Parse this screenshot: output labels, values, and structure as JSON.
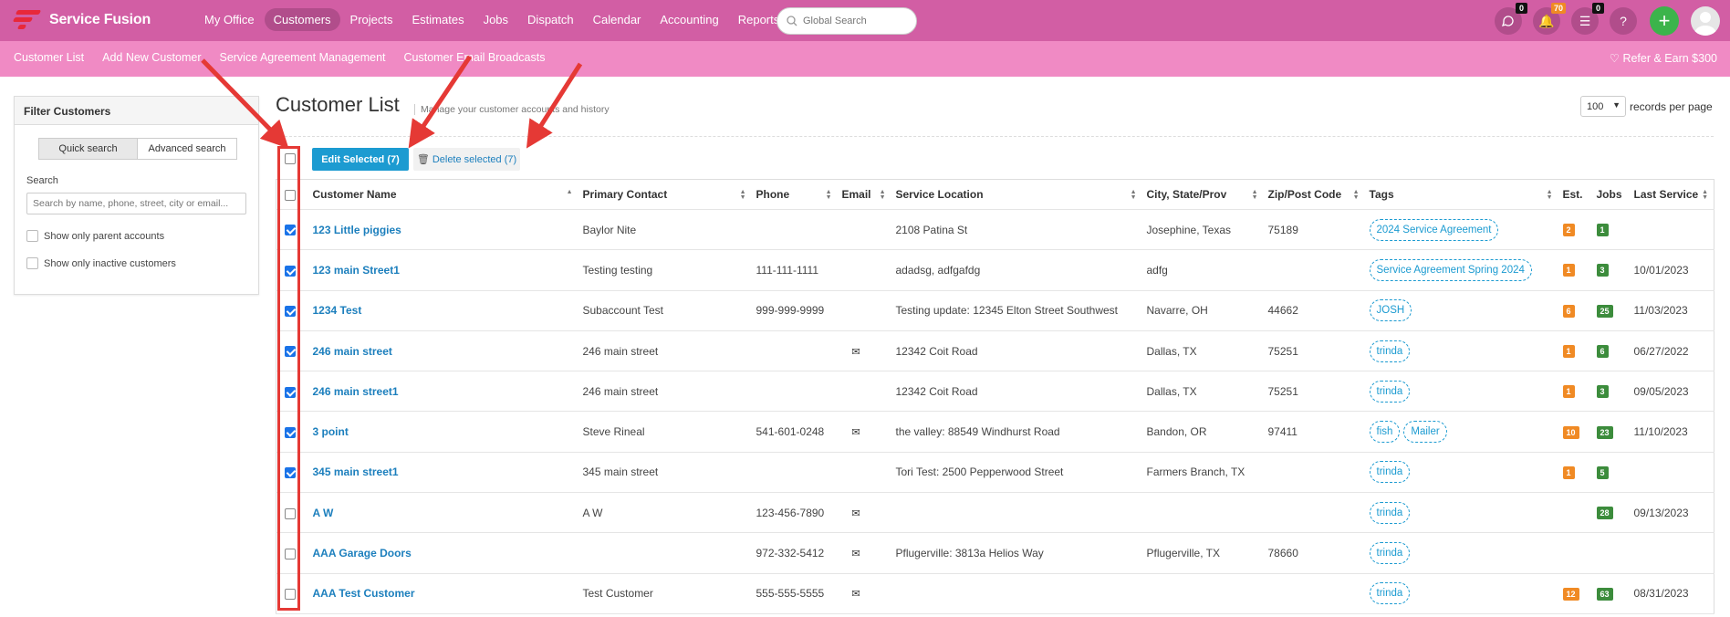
{
  "app": {
    "brand": "Service Fusion",
    "nav": [
      "My Office",
      "Customers",
      "Projects",
      "Estimates",
      "Jobs",
      "Dispatch",
      "Calendar",
      "Accounting",
      "Reports"
    ],
    "active_nav": "Customers",
    "search_placeholder": "Global Search",
    "chat_badge": "0",
    "bell_badge": "70",
    "list_badge": "0",
    "help": "?",
    "plus": "+"
  },
  "subnav": {
    "items": [
      "Customer List",
      "Add New Customer",
      "Service Agreement Management",
      "Customer Email Broadcasts"
    ],
    "refer": "Refer & Earn $300"
  },
  "filter": {
    "title": "Filter Customers",
    "quick": "Quick search",
    "advanced": "Advanced search",
    "search_label": "Search",
    "search_placeholder": "Search by name, phone, street, city or email...",
    "parent_only": "Show only parent accounts",
    "inactive_only": "Show only inactive customers"
  },
  "main": {
    "title": "Customer List",
    "subtitle": "Manage your customer accounts and history",
    "records_value": "100",
    "records_label": "records per page",
    "edit_selected": "Edit Selected (7)",
    "delete_selected": "Delete selected (7)"
  },
  "table": {
    "headers": [
      "Customer Name",
      "Primary Contact",
      "Phone",
      "Email",
      "Service Location",
      "City, State/Prov",
      "Zip/Post Code",
      "Tags",
      "Est.",
      "Jobs",
      "Last Service"
    ],
    "rows": [
      {
        "checked": true,
        "name": "123 Little piggies",
        "contact": "Baylor Nite",
        "phone": "",
        "email": false,
        "location": "2108 Patina St",
        "city": "Josephine, Texas",
        "zip": "75189",
        "tags": [
          "2024 Service Agreement"
        ],
        "est": "2",
        "jobs": "1",
        "last": ""
      },
      {
        "checked": true,
        "name": "123 main Street1",
        "contact": "Testing testing",
        "phone": "111-111-1111",
        "email": false,
        "location": "adadsg, adfgafdg",
        "city": "adfg",
        "zip": "",
        "tags": [
          "Service Agreement Spring 2024"
        ],
        "est": "1",
        "jobs": "3",
        "last": "10/01/2023"
      },
      {
        "checked": true,
        "name": "1234 Test",
        "contact": "Subaccount Test",
        "phone": "999-999-9999",
        "email": false,
        "location": "Testing update: 12345 Elton Street Southwest",
        "city": "Navarre, OH",
        "zip": "44662",
        "tags": [
          "JOSH"
        ],
        "est": "6",
        "jobs": "25",
        "last": "11/03/2023"
      },
      {
        "checked": true,
        "name": "246 main street",
        "contact": "246 main street",
        "phone": "",
        "email": true,
        "location": "12342 Coit Road",
        "city": "Dallas, TX",
        "zip": "75251",
        "tags": [
          "trinda"
        ],
        "est": "1",
        "jobs": "6",
        "last": "06/27/2022"
      },
      {
        "checked": true,
        "name": "246 main street1",
        "contact": "246 main street",
        "phone": "",
        "email": false,
        "location": "12342 Coit Road",
        "city": "Dallas, TX",
        "zip": "75251",
        "tags": [
          "trinda"
        ],
        "est": "1",
        "jobs": "3",
        "last": "09/05/2023"
      },
      {
        "checked": true,
        "name": "3 point",
        "contact": "Steve Rineal",
        "phone": "541-601-0248",
        "email": true,
        "location": "the valley: 88549 Windhurst Road",
        "city": "Bandon, OR",
        "zip": "97411",
        "tags": [
          "fish",
          "Mailer"
        ],
        "est": "10",
        "jobs": "23",
        "last": "11/10/2023"
      },
      {
        "checked": true,
        "name": "345 main street1",
        "contact": "345 main street",
        "phone": "",
        "email": false,
        "location": "Tori Test: 2500 Pepperwood Street",
        "city": "Farmers Branch, TX",
        "zip": "",
        "tags": [
          "trinda"
        ],
        "est": "1",
        "jobs": "5",
        "last": ""
      },
      {
        "checked": false,
        "name": "A W",
        "contact": "A W",
        "phone": "123-456-7890",
        "email": true,
        "location": "",
        "city": "",
        "zip": "",
        "tags": [
          "trinda"
        ],
        "est": "",
        "jobs": "28",
        "last": "09/13/2023"
      },
      {
        "checked": false,
        "name": "AAA Garage Doors",
        "contact": "",
        "phone": "972-332-5412",
        "email": true,
        "location": "Pflugerville: 3813a Helios Way",
        "city": "Pflugerville, TX",
        "zip": "78660",
        "tags": [
          "trinda"
        ],
        "est": "",
        "jobs": "",
        "last": ""
      },
      {
        "checked": false,
        "name": "AAA Test Customer",
        "contact": "Test Customer",
        "phone": "555-555-5555",
        "email": true,
        "location": "",
        "city": "",
        "zip": "",
        "tags": [
          "trinda"
        ],
        "est": "12",
        "jobs": "63",
        "last": "08/31/2023"
      }
    ]
  },
  "colors": {
    "topbar": "#d25ea4",
    "subbar": "#f08ac4",
    "link": "#1c7fbd",
    "annotation": "#e53935"
  }
}
